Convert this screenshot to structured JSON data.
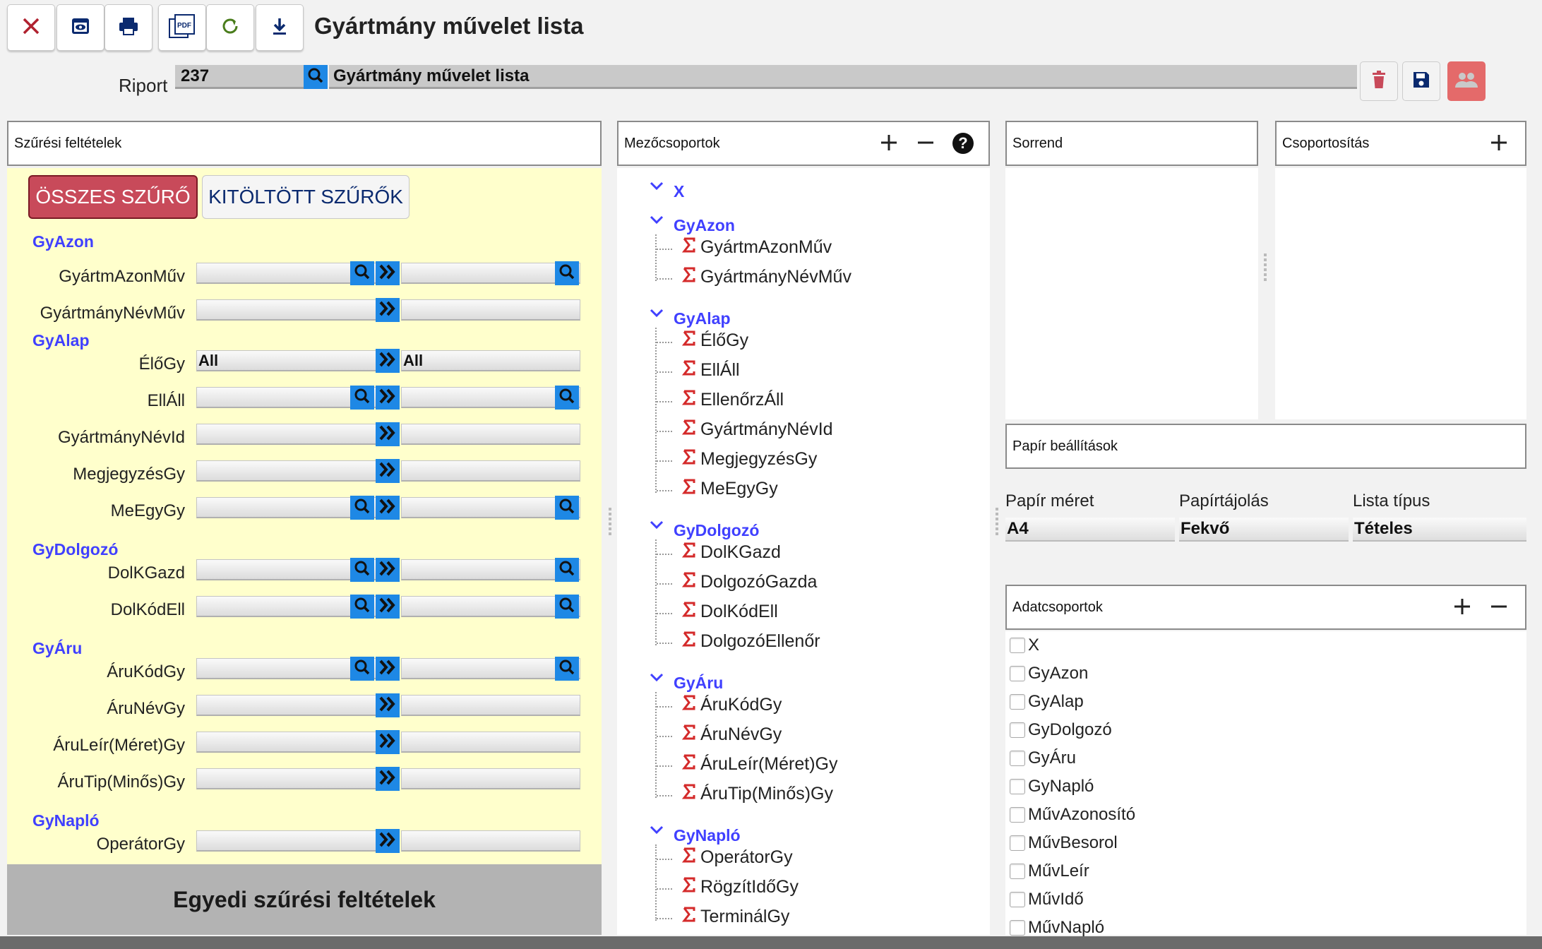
{
  "toolbar": {
    "icons": [
      "close-icon",
      "preview-icon",
      "print-icon",
      "pdf-icon",
      "refresh-icon",
      "download-icon"
    ],
    "pdf_label": "PDF"
  },
  "title": "Gyártmány művelet lista",
  "riport": {
    "label": "Riport",
    "code": "237",
    "name": "Gyártmány művelet lista"
  },
  "colors": {
    "accent": "#1e88e5",
    "group": "#4040ff",
    "danger": "#c84a5a",
    "yellow": "#ffffcc"
  },
  "filters": {
    "header": "Szűrési feltételek",
    "tab_all": "ÖSSZES SZŰRŐ",
    "tab_filled": "KITÖLTÖTT SZŰRŐK",
    "groups": [
      "GyAzon",
      "GyAlap",
      "GyDolgozó",
      "GyÁru",
      "GyNapló"
    ],
    "fields": [
      "GyártmAzonMűv",
      "GyártmányNévMűv",
      "ÉlőGy",
      "EllÁll",
      "GyártmányNévId",
      "MegjegyzésGy",
      "MeEgyGy",
      "DolKGazd",
      "DolKódEll",
      "ÁruKódGy",
      "ÁruNévGy",
      "ÁruLeír(Méret)Gy",
      "ÁruTip(Minős)Gy",
      "OperátorGy"
    ],
    "elogy_from": "All",
    "elogy_to": "All",
    "bottom": "Egyedi szűrési feltételek"
  },
  "fieldgroups": {
    "header": "Mezőcsoportok",
    "groups": [
      "X",
      "GyAzon",
      "GyAlap",
      "GyDolgozó",
      "GyÁru",
      "GyNapló"
    ],
    "items": {
      "gyazon": [
        "GyártmAzonMűv",
        "GyártmányNévMűv"
      ],
      "gyalap": [
        "ÉlőGy",
        "EllÁll",
        "EllenőrzÁll",
        "GyártmányNévId",
        "MegjegyzésGy",
        "MeEgyGy"
      ],
      "gydolgozo": [
        "DolKGazd",
        "DolgozóGazda",
        "DolKódEll",
        "DolgozóEllenőr"
      ],
      "gyaru": [
        "ÁruKódGy",
        "ÁruNévGy",
        "ÁruLeír(Méret)Gy",
        "ÁruTip(Minős)Gy"
      ],
      "gynaplo": [
        "OperátorGy",
        "RögzítIdőGy",
        "TerminálGy"
      ]
    }
  },
  "sort": {
    "header": "Sorrend"
  },
  "grouping": {
    "header": "Csoportosítás"
  },
  "paper": {
    "header": "Papír beállítások",
    "size_label": "Papír méret",
    "size_value": "A4",
    "orient_label": "Papírtájolás",
    "orient_value": "Fekvő",
    "list_label": "Lista típus",
    "list_value": "Tételes"
  },
  "datasets": {
    "header": "Adatcsoportok",
    "items": [
      "X",
      "GyAzon",
      "GyAlap",
      "GyDolgozó",
      "GyÁru",
      "GyNapló",
      "MűvAzonosító",
      "MűvBesorol",
      "MűvLeír",
      "MűvIdő",
      "MűvNapló"
    ]
  }
}
